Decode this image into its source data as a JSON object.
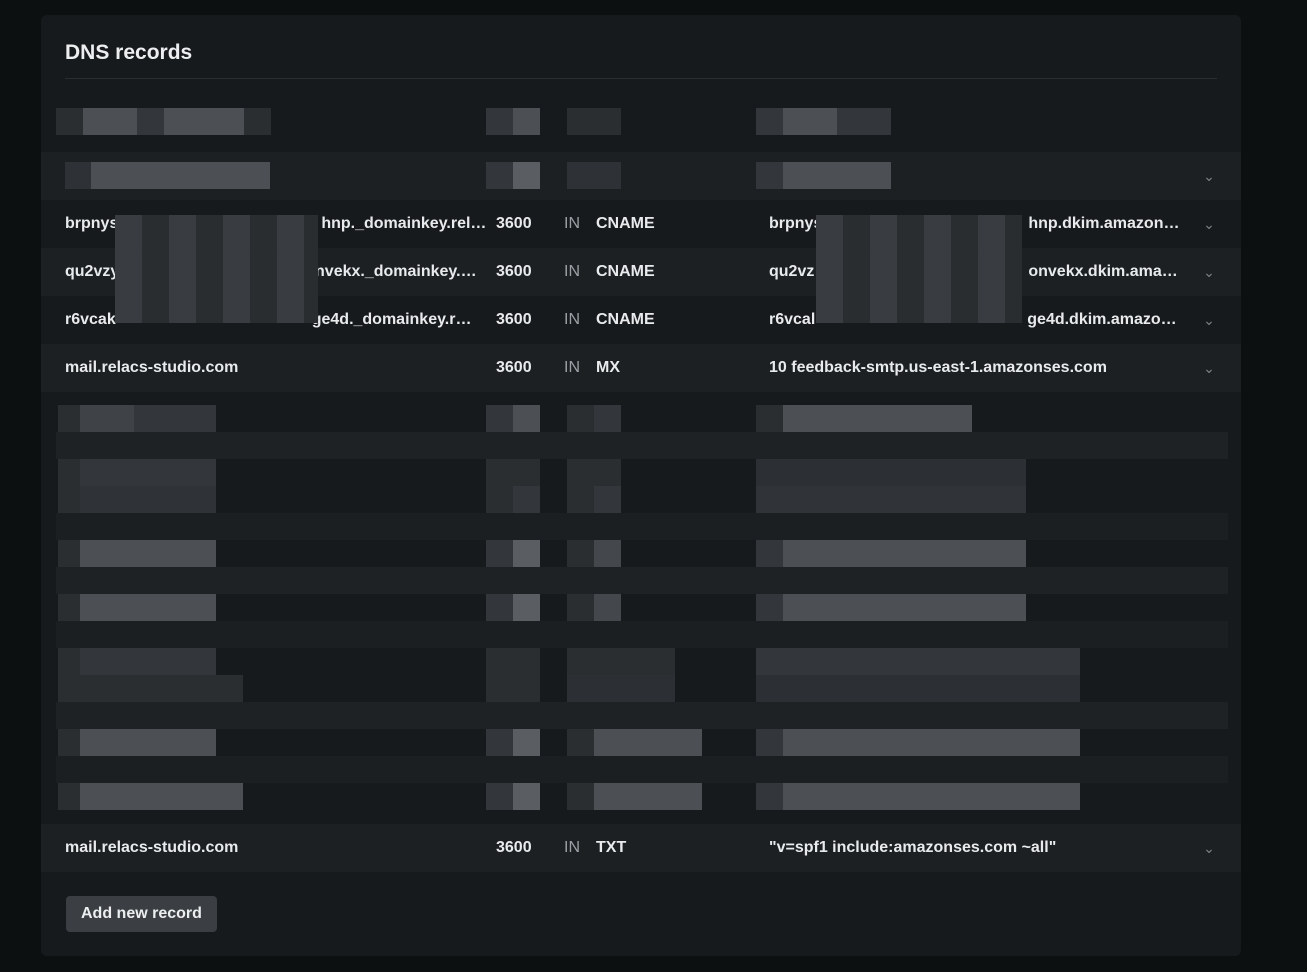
{
  "panel": {
    "title": "DNS records",
    "add_button_label": "Add new record"
  },
  "records": [
    {
      "name": "brpnys…hnp._domainkey.rel…",
      "name_prefix": "brpnys",
      "name_suffix": "hnp._domainkey.rel…",
      "ttl": "3600",
      "class": "IN",
      "type": "CNAME",
      "value_prefix": "brpnys",
      "value_suffix": "hnp.dkim.amazons…"
    },
    {
      "name_prefix": "qu2vzy",
      "name_suffix": "onvekx._domainkey.…",
      "ttl": "3600",
      "class": "IN",
      "type": "CNAME",
      "value_prefix": "qu2vz",
      "value_suffix": "onvekx.dkim.amazo…"
    },
    {
      "name_prefix": "r6vcak",
      "name_suffix": "ge4d._domainkey.r…",
      "ttl": "3600",
      "class": "IN",
      "type": "CNAME",
      "value_prefix": "r6vcal",
      "value_suffix": "ge4d.dkim.amazon…"
    },
    {
      "name": "mail.relacs-studio.com",
      "ttl": "3600",
      "class": "IN",
      "type": "MX",
      "value": "10 feedback-smtp.us-east-1.amazonses.com"
    },
    {
      "name": "mail.relacs-studio.com",
      "ttl": "3600",
      "class": "IN",
      "type": "TXT",
      "value": "\"v=spf1 include:amazonses.com ~all\""
    }
  ],
  "icons": {
    "expand": "chevron-down-icon"
  },
  "colors": {
    "background": "#0d1011",
    "panel": "#171a1c",
    "row_alt": "#1c2022",
    "button": "#3b3f43",
    "text": "#eceef0",
    "muted": "#9aa0a5"
  }
}
